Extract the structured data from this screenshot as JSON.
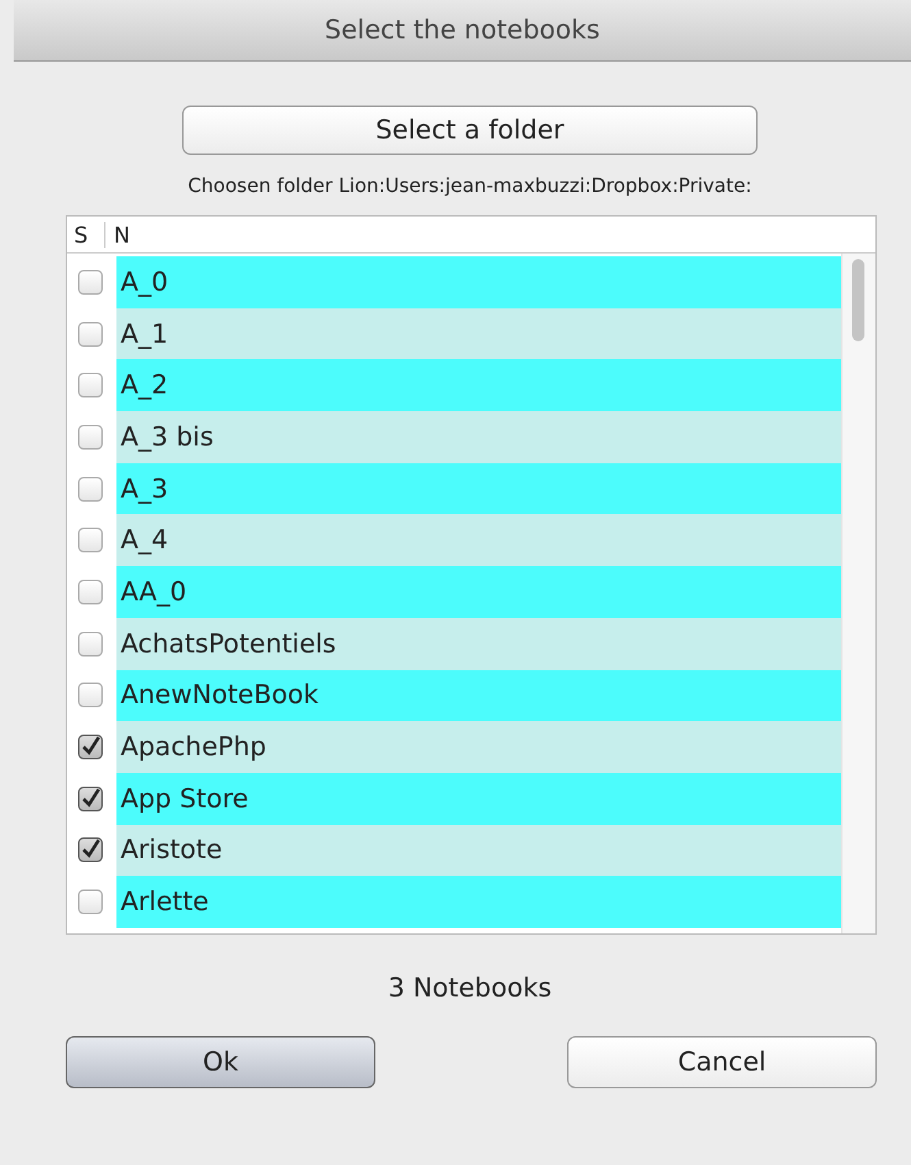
{
  "window": {
    "title": "Select the notebooks"
  },
  "folder_button": "Select a folder",
  "folder_label": "Choosen folder Lion:Users:jean-maxbuzzi:Dropbox:Private:",
  "table": {
    "columns": [
      "S",
      "N"
    ],
    "rows": [
      {
        "name": "A_0",
        "checked": false
      },
      {
        "name": "A_1",
        "checked": false
      },
      {
        "name": "A_2",
        "checked": false
      },
      {
        "name": "A_3 bis",
        "checked": false
      },
      {
        "name": "A_3",
        "checked": false
      },
      {
        "name": "A_4",
        "checked": false
      },
      {
        "name": "AA_0",
        "checked": false
      },
      {
        "name": "AchatsPotentiels",
        "checked": false
      },
      {
        "name": "AnewNoteBook",
        "checked": false
      },
      {
        "name": "ApachePhp",
        "checked": true
      },
      {
        "name": "App Store",
        "checked": true
      },
      {
        "name": "Aristote",
        "checked": true
      },
      {
        "name": "Arlette",
        "checked": false
      }
    ]
  },
  "count": "3 Notebooks",
  "buttons": [
    {
      "label": "Ok",
      "default": true
    },
    {
      "label": "Cancel",
      "default": false
    }
  ]
}
